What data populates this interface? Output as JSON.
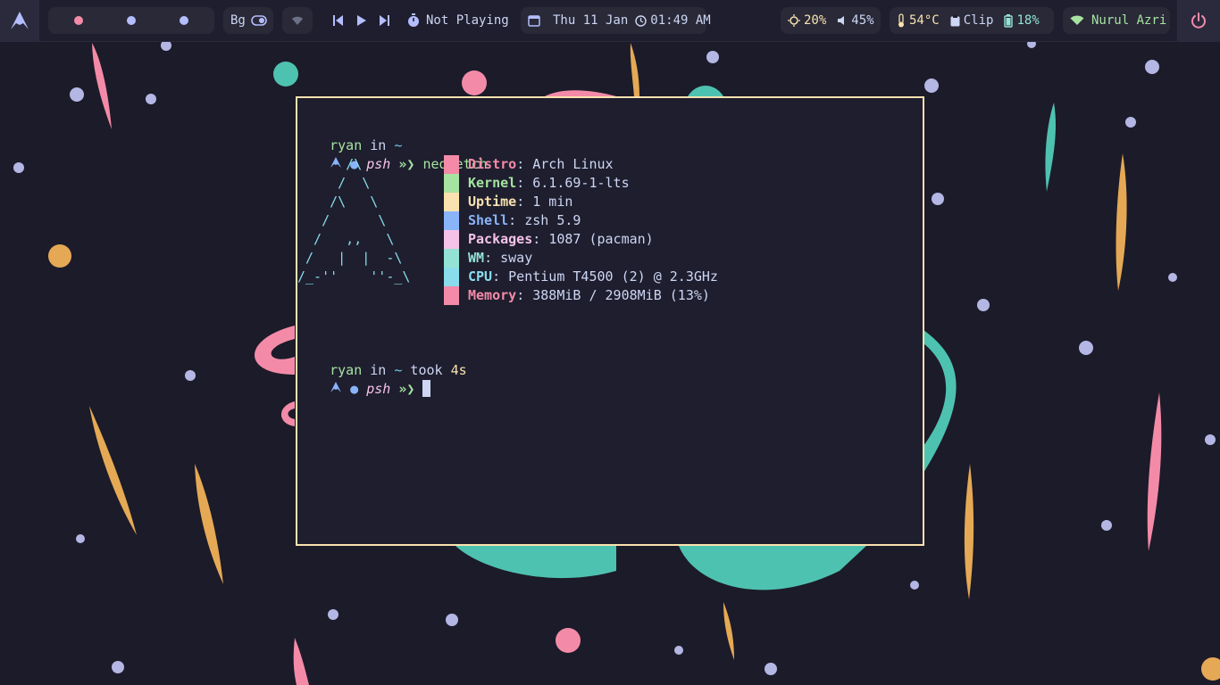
{
  "colors": {
    "bar_bg": "#1e1e2e",
    "pill_bg": "#292938",
    "accent_purple": "#b4befe",
    "accent_pink": "#f38ba8",
    "accent_green": "#a6e3a1",
    "accent_yellow": "#f9e2af",
    "accent_teal": "#94e2d5",
    "terminal_border": "#f9e2af"
  },
  "topbar": {
    "launcher_icon": "arch-logo-icon",
    "workspaces": [
      {
        "color": "#f38ba8",
        "active": true
      },
      {
        "color": "#b4befe",
        "active": false
      },
      {
        "color": "#b4befe",
        "active": false
      }
    ],
    "bg_toggle": {
      "label": "Bg",
      "icon": "toggle-icon",
      "on": true
    },
    "notifications_icon": "wifi-tray-icon",
    "media": {
      "prev_icon": "skip-back-icon",
      "play_icon": "play-icon",
      "next_icon": "skip-forward-icon",
      "status_icon": "timer-icon",
      "status": "Not Playing"
    },
    "clock": {
      "calendar_icon": "calendar-icon",
      "date": "Thu 11 Jan",
      "clock_icon": "clock-icon",
      "time": "01:49 AM"
    },
    "brightness": {
      "icon": "brightness-icon",
      "value": "20%"
    },
    "volume": {
      "icon": "volume-icon",
      "value": "45%"
    },
    "temperature": {
      "icon": "thermometer-icon",
      "value": "54°C"
    },
    "clipboard": {
      "icon": "clipboard-icon",
      "label": "Clip"
    },
    "battery": {
      "icon": "battery-icon",
      "value": "18%"
    },
    "network": {
      "icon": "wifi-icon",
      "ssid": "Nurul Azri"
    },
    "power_icon": "power-icon"
  },
  "terminal": {
    "prompt1": {
      "user": "ryan",
      "in": " in ",
      "dir": "~"
    },
    "cmd1": {
      "shell": "psh",
      "command": "neofetch"
    },
    "ascii_art": [
      "      /\\",
      "     /  \\",
      "    /\\   \\",
      "   /      \\",
      "  /   ,,   \\",
      " /   |  |  -\\",
      "/_-''    ''-_\\"
    ],
    "info": [
      {
        "key": "Distro",
        "value": "Arch Linux",
        "color": "#f38ba8"
      },
      {
        "key": "Kernel",
        "value": "6.1.69-1-lts",
        "color": "#a6e3a1"
      },
      {
        "key": "Uptime",
        "value": "1 min",
        "color": "#f9e2af"
      },
      {
        "key": "Shell",
        "value": "zsh 5.9",
        "color": "#89b4fa"
      },
      {
        "key": "Packages",
        "value": "1087 (pacman)",
        "color": "#f5c2e7"
      },
      {
        "key": "WM",
        "value": "sway",
        "color": "#94e2d5"
      },
      {
        "key": "CPU",
        "value": "Pentium T4500 (2) @ 2.3GHz",
        "color": "#89dceb"
      },
      {
        "key": "Memory",
        "value": "388MiB / 2908MiB (13%)",
        "color": "#f38ba8"
      }
    ],
    "separator": ": ",
    "prompt2": {
      "user": "ryan",
      "in": " in ",
      "dir": "~",
      "took": " took ",
      "duration": "4s"
    },
    "cmd2": {
      "shell": "psh",
      "command": ""
    }
  }
}
